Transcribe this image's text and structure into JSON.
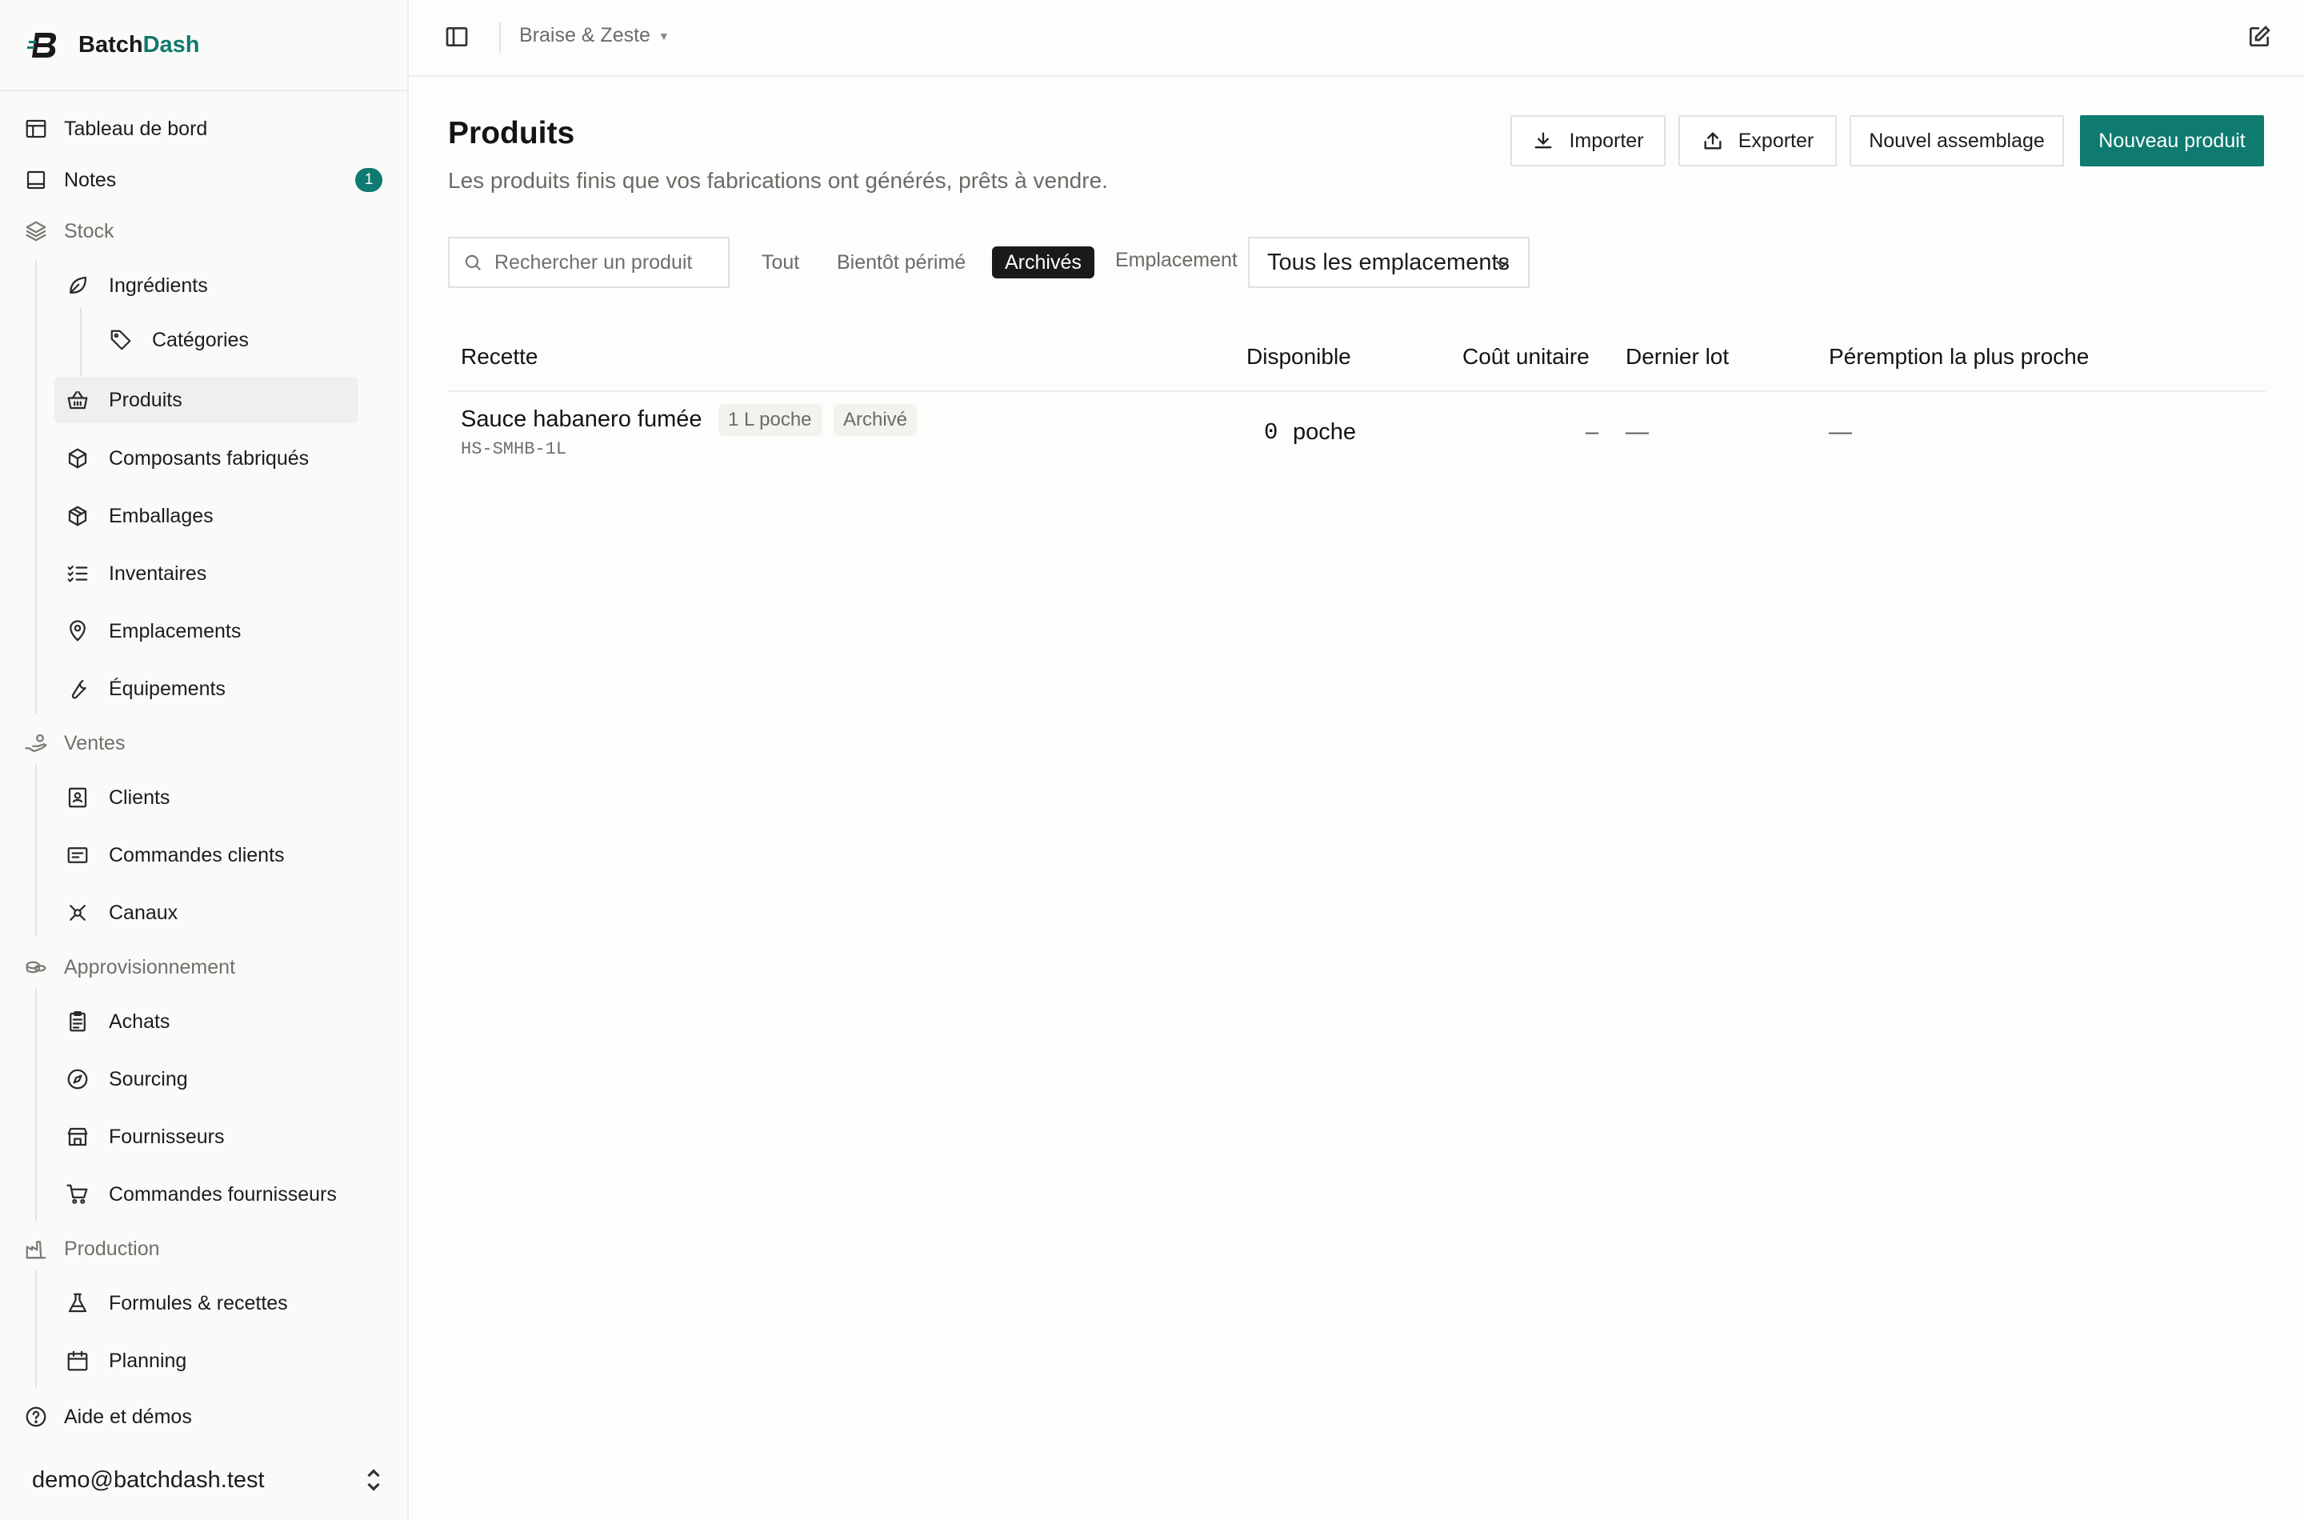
{
  "brand": {
    "name_part1": "Batch",
    "name_part2": "Dash",
    "accent_color": "#0e7a70"
  },
  "sidebar": {
    "items": [
      {
        "label": "Tableau de bord",
        "icon": "dashboard-icon"
      },
      {
        "label": "Notes",
        "icon": "notes-icon",
        "badge": "1"
      },
      {
        "label": "Stock",
        "icon": "layers-icon"
      },
      {
        "label": "Ingrédients",
        "icon": "leaf-icon"
      },
      {
        "label": "Catégories",
        "icon": "tag-icon"
      },
      {
        "label": "Produits",
        "icon": "basket-icon"
      },
      {
        "label": "Composants fabriqués",
        "icon": "cube-icon"
      },
      {
        "label": "Emballages",
        "icon": "package-icon"
      },
      {
        "label": "Inventaires",
        "icon": "checklist-icon"
      },
      {
        "label": "Emplacements",
        "icon": "map-pin-icon"
      },
      {
        "label": "Équipements",
        "icon": "wrench-icon"
      },
      {
        "label": "Ventes",
        "icon": "hand-coins-icon"
      },
      {
        "label": "Clients",
        "icon": "contact-icon"
      },
      {
        "label": "Commandes clients",
        "icon": "receipt-icon"
      },
      {
        "label": "Canaux",
        "icon": "satellite-icon"
      },
      {
        "label": "Approvisionnement",
        "icon": "truck-icon"
      },
      {
        "label": "Achats",
        "icon": "clipboard-icon"
      },
      {
        "label": "Sourcing",
        "icon": "compass-icon"
      },
      {
        "label": "Fournisseurs",
        "icon": "store-icon"
      },
      {
        "label": "Commandes fournisseurs",
        "icon": "cart-icon"
      },
      {
        "label": "Production",
        "icon": "factory-icon"
      },
      {
        "label": "Formules & recettes",
        "icon": "flask-icon"
      },
      {
        "label": "Planning",
        "icon": "calendar-icon"
      },
      {
        "label": "Aide et démos",
        "icon": "help-icon"
      }
    ],
    "user_email": "demo@batchdash.test"
  },
  "topbar": {
    "workspace": "Braise & Zeste"
  },
  "main": {
    "title": "Produits",
    "subtitle": "Les produits finis que vos fabrications ont générés, prêts à vendre.",
    "buttons": {
      "import": "Importer",
      "export": "Exporter",
      "new_assembly": "Nouvel assemblage",
      "new_product": "Nouveau produit"
    },
    "search_placeholder": "Rechercher un produit",
    "filters": {
      "all": "Tout",
      "expiring": "Bientôt périmé",
      "archived": "Archivés",
      "location_label": "Emplacement",
      "location_value": "Tous les emplacements"
    },
    "table": {
      "headers": [
        "Recette",
        "Disponible",
        "Coût unitaire",
        "Dernier lot",
        "Péremption la plus proche"
      ],
      "rows": [
        {
          "name": "Sauce habanero fumée",
          "format_tag": "1 L poche",
          "status_tag": "Archivé",
          "sku": "HS-SMHB-1L",
          "qty": "0",
          "unit": "poche",
          "cost": "–",
          "last_lot": "—",
          "expiry": "—"
        }
      ]
    }
  }
}
